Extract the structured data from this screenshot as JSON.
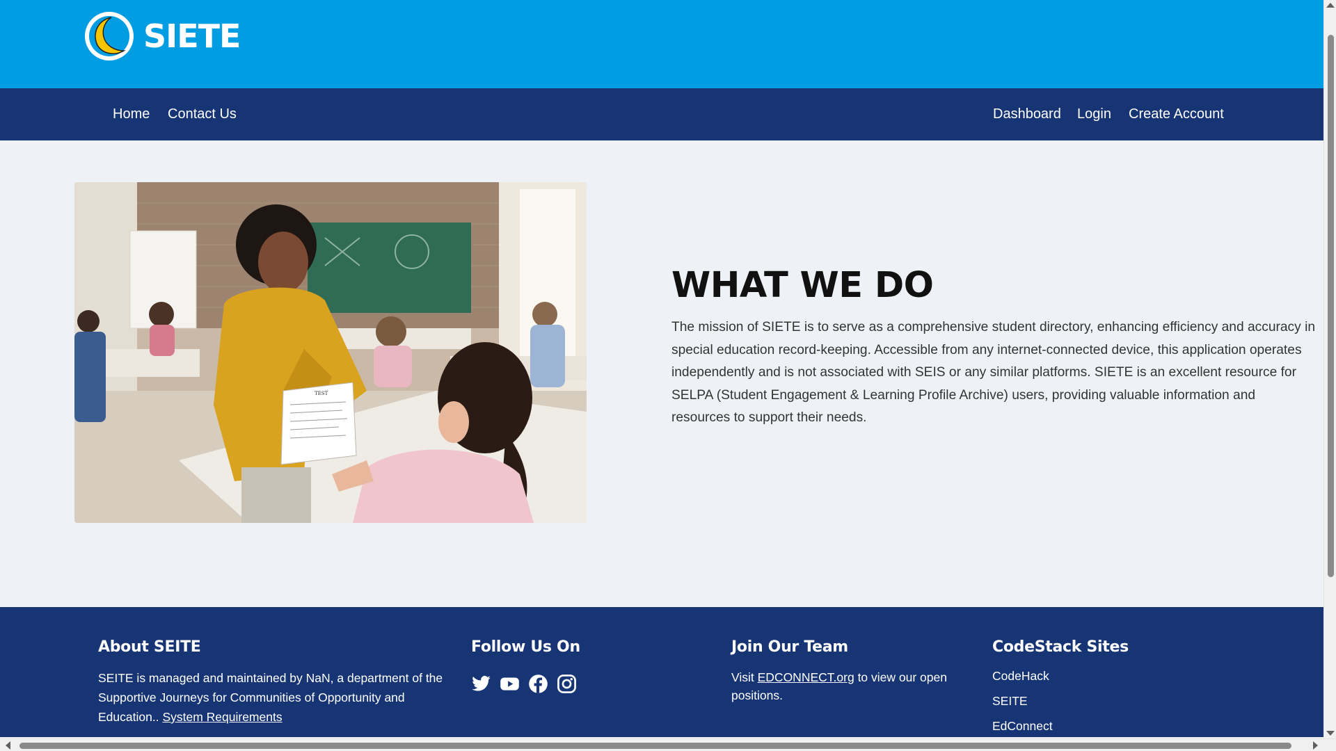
{
  "brand": {
    "name": "SIETE"
  },
  "nav": {
    "left": [
      {
        "label": "Home"
      },
      {
        "label": "Contact Us"
      }
    ],
    "right": [
      {
        "label": "Dashboard"
      },
      {
        "label": "Login"
      },
      {
        "label": "Create Account"
      }
    ]
  },
  "hero": {
    "image_paper_label": "TEST",
    "title": "WHAT WE DO",
    "body": "The mission of SIETE is to serve as a comprehensive student directory, enhancing efficiency and accuracy in special education record-keeping. Accessible from any internet-connected device, this application operates independently and is not associated with SEIS or any similar platforms. SIETE is an excellent resource for SELPA (Student Engagement & Learning Profile Archive) users, providing valuable information and resources to support their needs."
  },
  "footer": {
    "about": {
      "heading": "About SEITE",
      "text": "SEITE is managed and maintained by NaN, a department of the Supportive Journeys for Communities of Opportunity and Education..",
      "link": "System Requirements"
    },
    "follow": {
      "heading": "Follow Us On",
      "icons": [
        "twitter-icon",
        "youtube-icon",
        "facebook-icon",
        "instagram-icon"
      ]
    },
    "join": {
      "heading": "Join Our Team",
      "prefix": "Visit",
      "link": "EDCONNECT.org",
      "suffix": "to view our open positions."
    },
    "sites": {
      "heading": "CodeStack Sites",
      "links": [
        "CodeHack",
        "SEITE",
        "EdConnect"
      ]
    }
  },
  "colors": {
    "topbar": "#009de3",
    "navbar": "#173574",
    "footer": "#173574",
    "page_bg": "#eef2f6",
    "logo_moon": "#f3c400"
  }
}
